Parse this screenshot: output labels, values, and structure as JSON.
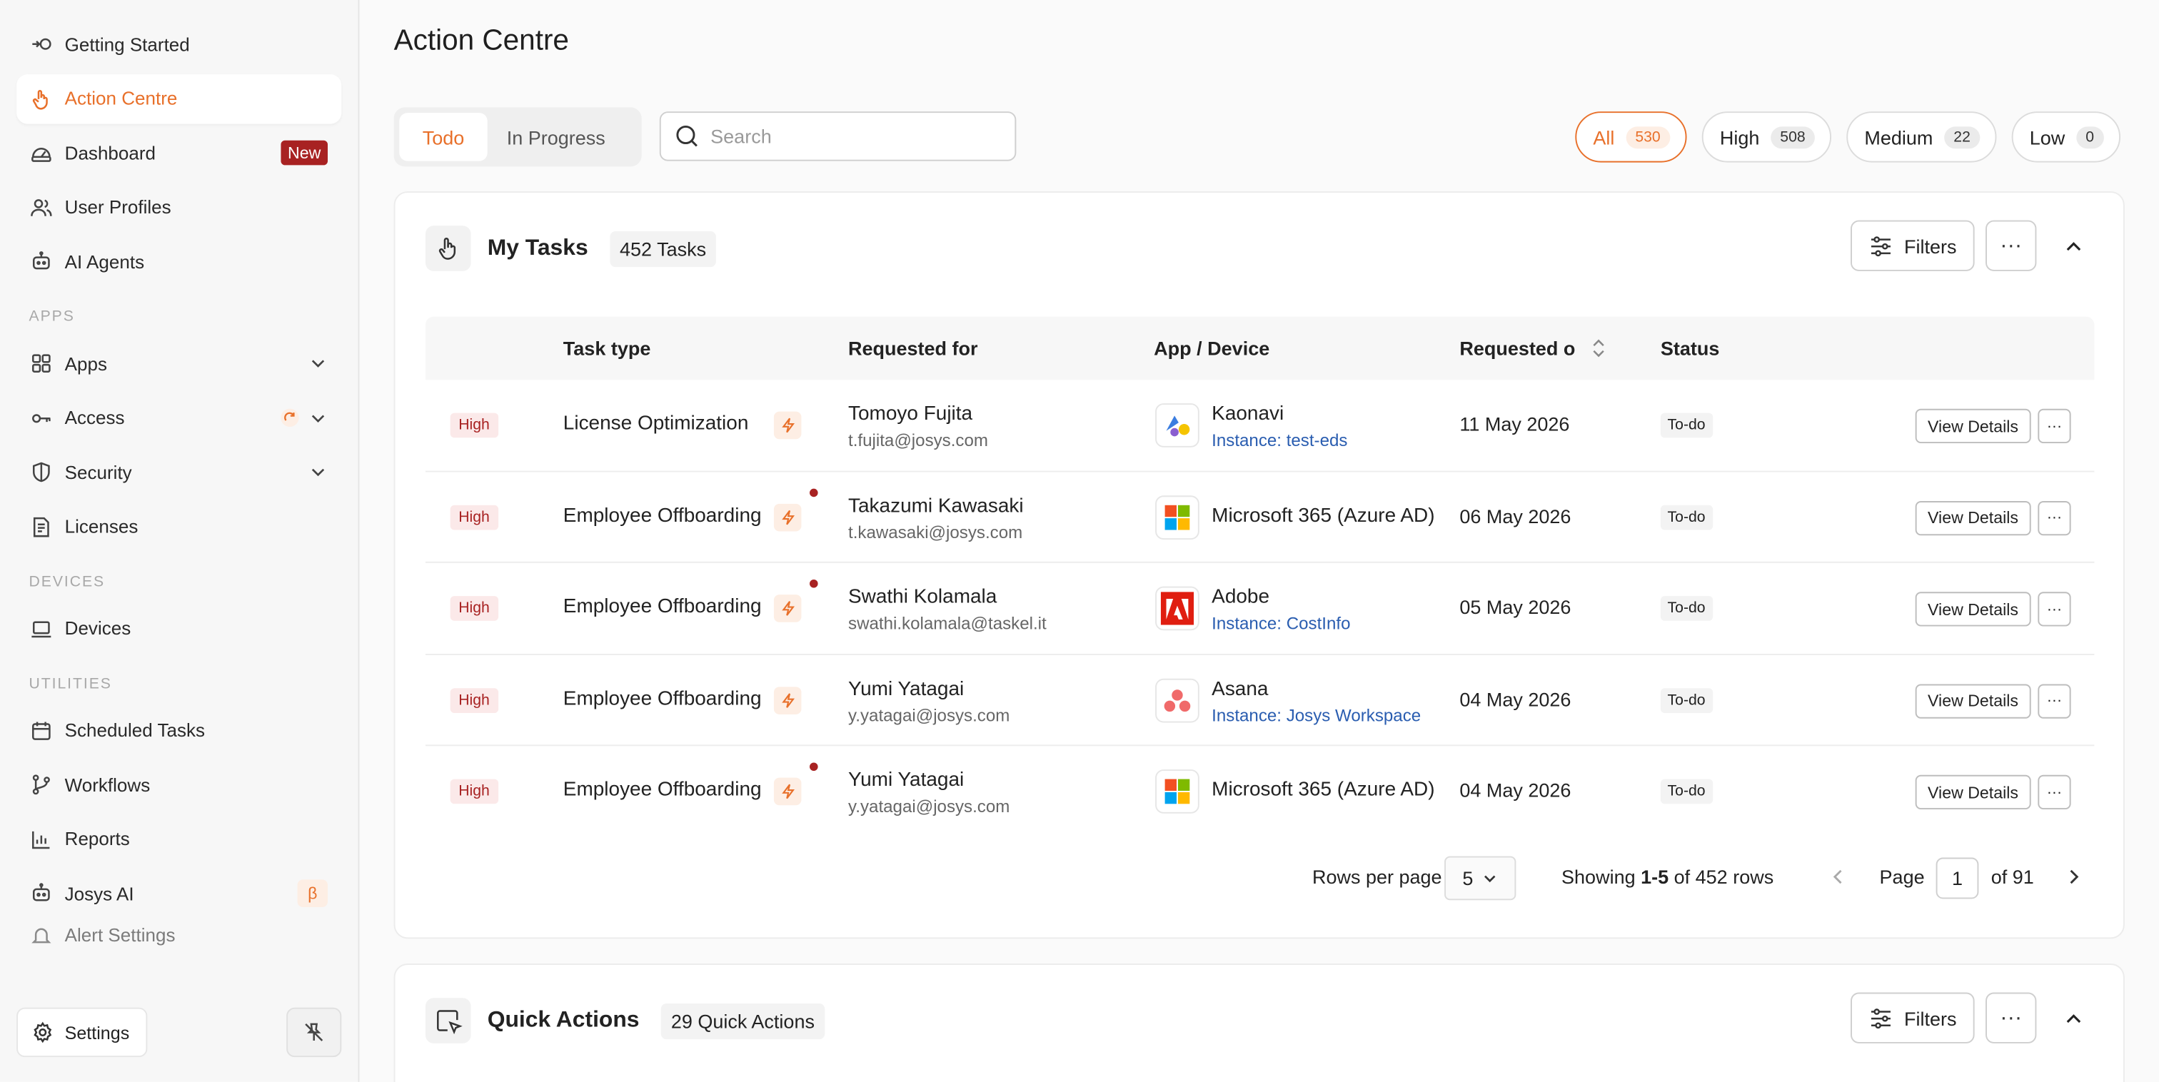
{
  "sidebar": {
    "items_top": [
      {
        "label": "Getting Started",
        "icon": "getting-started-icon"
      },
      {
        "label": "Action Centre",
        "icon": "hand-icon",
        "active": true
      },
      {
        "label": "Dashboard",
        "icon": "dashboard-icon",
        "badge": "New"
      },
      {
        "label": "User Profiles",
        "icon": "users-icon"
      },
      {
        "label": "AI Agents",
        "icon": "robot-icon"
      }
    ],
    "section_apps": "APPS",
    "apps_items": [
      {
        "label": "Apps"
      },
      {
        "label": "Access"
      },
      {
        "label": "Security"
      },
      {
        "label": "Licenses"
      }
    ],
    "section_devices": "DEVICES",
    "devices_items": [
      {
        "label": "Devices"
      }
    ],
    "section_utilities": "UTILITIES",
    "utilities_items": [
      {
        "label": "Scheduled Tasks"
      },
      {
        "label": "Workflows"
      },
      {
        "label": "Reports"
      },
      {
        "label": "Josys AI",
        "badge": "β"
      },
      {
        "label": "Alert Settings"
      }
    ],
    "settings_label": "Settings"
  },
  "main": {
    "title": "Action Centre",
    "tabs": [
      {
        "label": "Todo"
      },
      {
        "label": "In Progress"
      }
    ],
    "search": {
      "placeholder": "Search",
      "value": ""
    },
    "priority_filters": [
      {
        "label": "All",
        "count": "530"
      },
      {
        "label": "High",
        "count": "508"
      },
      {
        "label": "Medium",
        "count": "22"
      },
      {
        "label": "Low",
        "count": "0"
      }
    ]
  },
  "tasks_card": {
    "title": "My Tasks",
    "count_label": "452 Tasks",
    "filters_label": "Filters",
    "columns": [
      "Task type",
      "Requested for",
      "App / Device",
      "Requested on",
      "Status"
    ],
    "rows": [
      {
        "priority": "High",
        "task_type": "License Optimization",
        "name": "Tomoyo Fujita",
        "email": "t.fujita@josys.com",
        "app": "Kaonavi",
        "instance": "Instance: test-eds",
        "date": "11 May 2026",
        "status": "To-do",
        "dot": false,
        "app_icon": "kaonavi-icon"
      },
      {
        "priority": "High",
        "task_type": "Employee Offboarding",
        "name": "Takazumi Kawasaki",
        "email": "t.kawasaki@josys.com",
        "app": "Microsoft 365 (Azure AD)",
        "instance": "",
        "date": "06 May 2026",
        "status": "To-do",
        "dot": true,
        "app_icon": "microsoft-icon"
      },
      {
        "priority": "High",
        "task_type": "Employee Offboarding",
        "name": "Swathi Kolamala",
        "email": "swathi.kolamala@taskel.it",
        "app": "Adobe",
        "instance": "Instance: CostInfo",
        "date": "05 May 2026",
        "status": "To-do",
        "dot": true,
        "app_icon": "adobe-icon"
      },
      {
        "priority": "High",
        "task_type": "Employee Offboarding",
        "name": "Yumi Yatagai",
        "email": "y.yatagai@josys.com",
        "app": "Asana",
        "instance": "Instance: Josys Workspace",
        "date": "04 May 2026",
        "status": "To-do",
        "dot": false,
        "app_icon": "asana-icon"
      },
      {
        "priority": "High",
        "task_type": "Employee Offboarding",
        "name": "Yumi Yatagai",
        "email": "y.yatagai@josys.com",
        "app": "Microsoft 365 (Azure AD)",
        "instance": "",
        "date": "04 May 2026",
        "status": "To-do",
        "dot": true,
        "app_icon": "microsoft-icon"
      }
    ],
    "view_details_label": "View Details",
    "pagination": {
      "rows_per_page_label": "Rows per page",
      "rows_per_page_value": "5",
      "showing_prefix": "Showing ",
      "showing_range": "1-5",
      "showing_suffix": " of 452 rows",
      "page_label": "Page",
      "page_value": "1",
      "page_total": "of 91"
    }
  },
  "quick_card": {
    "title": "Quick Actions",
    "count_label": "29 Quick Actions",
    "filters_label": "Filters"
  },
  "colors": {
    "accent": "#e8702a",
    "high": "#a82222",
    "link": "#2a5db0"
  }
}
